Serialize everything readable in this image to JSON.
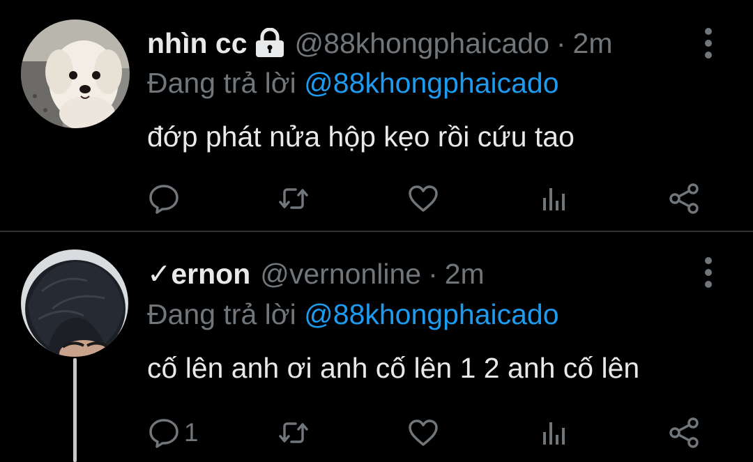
{
  "tweets": [
    {
      "display_name": "nhìn cc",
      "protected_icon": "lock-icon",
      "handle": "@88khongphaicado",
      "separator": "·",
      "time": "2m",
      "replying_prefix": "Đang trả lời",
      "replying_to": "@88khongphaicado",
      "text": "đớp phát nửa hộp kẹo rồi cứu tao",
      "reply_count": "",
      "avatar": "white-dog-avatar"
    },
    {
      "display_name": "✓ernon",
      "handle": "@vernonline",
      "separator": "·",
      "time": "2m",
      "replying_prefix": "Đang trả lời",
      "replying_to": "@88khongphaicado",
      "text": "cố lên anh ơi anh cố lên 1 2 anh cố lên",
      "reply_count": "1",
      "avatar": "dark-hair-person-avatar"
    }
  ],
  "icons": {
    "reply": "reply-icon",
    "retweet": "retweet-icon",
    "like": "heart-icon",
    "analytics": "analytics-icon",
    "share": "share-icon",
    "more": "more-vertical-icon"
  },
  "colors": {
    "background": "#000000",
    "primary_text": "#e7e9ea",
    "secondary_text": "#71767b",
    "link": "#1d9bf0",
    "divider": "#2f3336"
  }
}
